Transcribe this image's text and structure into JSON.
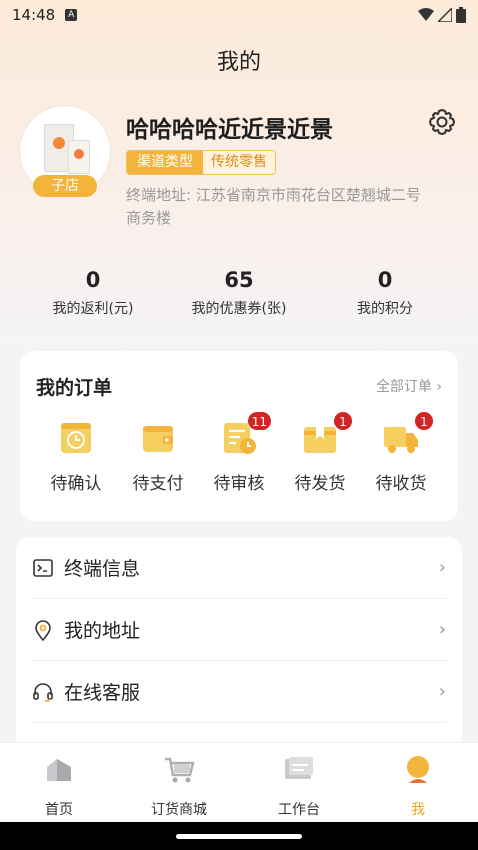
{
  "status_bar": {
    "time": "14:48",
    "a_badge": "A"
  },
  "page_title": "我的",
  "profile": {
    "name": "哈哈哈哈近近景近景",
    "shop_tag": "子店",
    "channel_label": "渠道类型",
    "channel_value": "传统零售",
    "address": "终端地址: 江苏省南京市雨花台区楚翘城二号商务楼"
  },
  "stats": [
    {
      "value": "0",
      "label": "我的返利(元)"
    },
    {
      "value": "65",
      "label": "我的优惠券(张)"
    },
    {
      "value": "0",
      "label": "我的积分"
    }
  ],
  "orders": {
    "title": "我的订单",
    "all_link": "全部订单",
    "items": [
      {
        "label": "待确认",
        "badge": ""
      },
      {
        "label": "待支付",
        "badge": ""
      },
      {
        "label": "待审核",
        "badge": "11"
      },
      {
        "label": "待发货",
        "badge": "1"
      },
      {
        "label": "待收货",
        "badge": "1"
      }
    ]
  },
  "menu": [
    {
      "label": "终端信息",
      "icon": "terminal-icon"
    },
    {
      "label": "我的地址",
      "icon": "location-pin-icon"
    },
    {
      "label": "在线客服",
      "icon": "headset-icon"
    }
  ],
  "tabs": [
    {
      "label": "首页",
      "icon": "home-icon",
      "active": false
    },
    {
      "label": "订货商城",
      "icon": "cart-icon",
      "active": false
    },
    {
      "label": "工作台",
      "icon": "workbench-icon",
      "active": false
    },
    {
      "label": "我",
      "icon": "profile-icon",
      "active": true
    }
  ],
  "colors": {
    "accent": "#f2b43a",
    "badge": "#d32424",
    "active_tab": "#f2a31f"
  }
}
